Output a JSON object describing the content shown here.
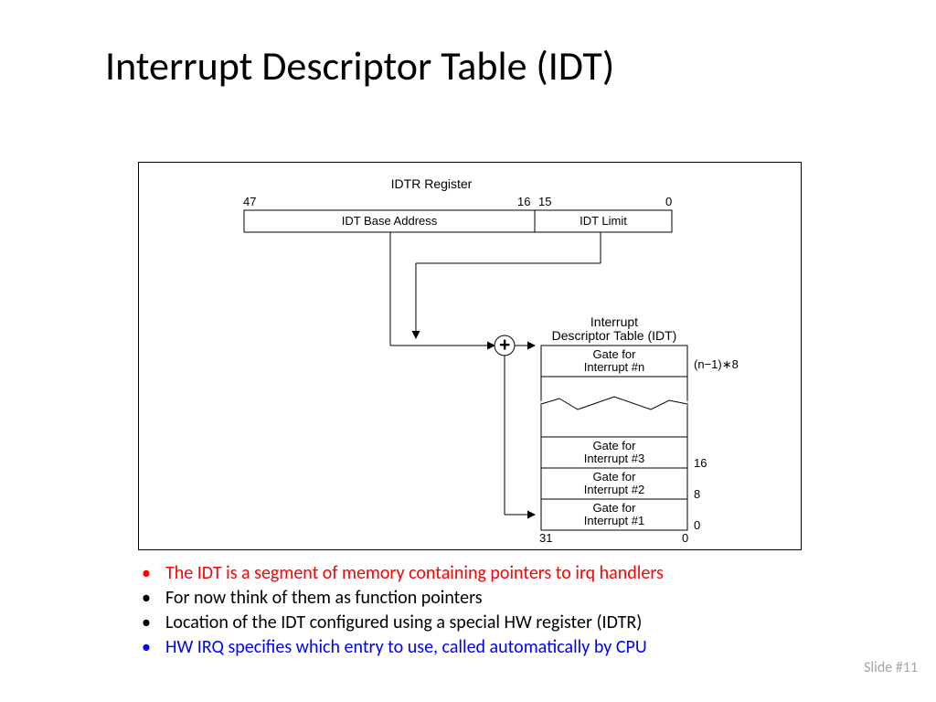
{
  "title": "Interrupt Descriptor Table (IDT)",
  "diagram": {
    "register_title": "IDTR Register",
    "bits": {
      "b47": "47",
      "b16": "16",
      "b15": "15",
      "b0": "0"
    },
    "base_addr": "IDT Base Address",
    "limit": "IDT Limit",
    "idt_title1": "Interrupt",
    "idt_title2": "Descriptor Table (IDT)",
    "gate_n1": "Gate for",
    "gate_n2": "Interrupt #n",
    "gate_3_1": "Gate for",
    "gate_3_2": "Interrupt #3",
    "gate_2_1": "Gate for",
    "gate_2_2": "Interrupt #2",
    "gate_1_1": "Gate for",
    "gate_1_2": "Interrupt #1",
    "off_n": "(n−1)∗8",
    "off_16": "16",
    "off_8": "8",
    "off_0": "0",
    "bot_31": "31",
    "bot_0": "0",
    "plus": "+"
  },
  "bullets": {
    "l1": "The IDT is a segment of memory containing pointers to irq handlers",
    "l2": "For now think of them as function pointers",
    "l3": "Location of the IDT configured using a special HW register (IDTR)",
    "l4": "HW IRQ specifies which entry to use, called automatically by CPU"
  },
  "slide_no": "Slide #11"
}
